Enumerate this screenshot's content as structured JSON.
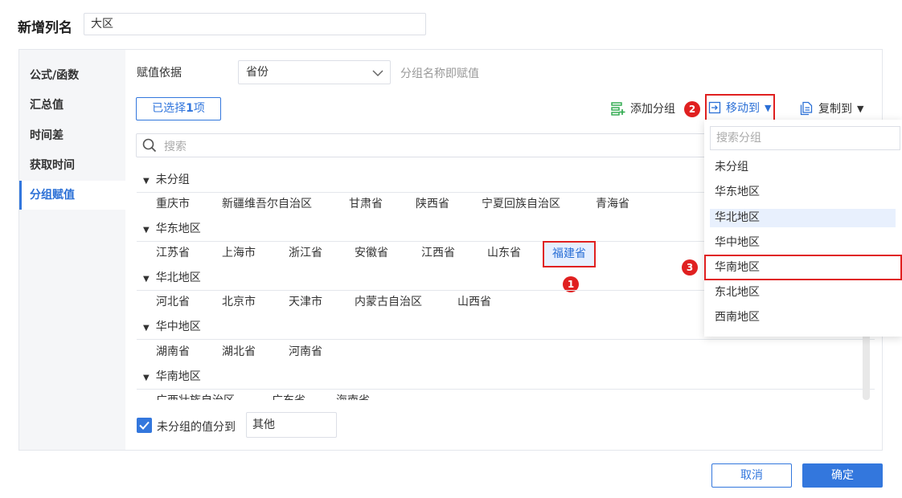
{
  "header": {
    "label": "新增列名",
    "value": "大区"
  },
  "sidebar": {
    "items": [
      {
        "label": "公式/函数"
      },
      {
        "label": "汇总值"
      },
      {
        "label": "时间差"
      },
      {
        "label": "获取时间"
      },
      {
        "label": "分组赋值",
        "active": true
      }
    ]
  },
  "basis": {
    "label": "赋值依据",
    "selected": "省份",
    "hint": "分组名称即赋值"
  },
  "selection": {
    "prefix": "已选择",
    "count": "1",
    "suffix": "项"
  },
  "toolbar": {
    "add_group": "添加分组",
    "move_to": "移动到",
    "copy_to": "复制到",
    "add_icon": "add-group-icon",
    "move_icon": "move-to-icon",
    "copy_icon": "copy-icon"
  },
  "search": {
    "placeholder": "搜索"
  },
  "groups": [
    {
      "name": "未分组",
      "items": [
        "重庆市",
        "新疆维吾尔自治区",
        "甘肃省",
        "陕西省",
        "宁夏回族自治区",
        "青海省"
      ]
    },
    {
      "name": "华东地区",
      "items": [
        "江苏省",
        "上海市",
        "浙江省",
        "安徽省",
        "江西省",
        "山东省",
        "福建省"
      ]
    },
    {
      "name": "华北地区",
      "items": [
        "河北省",
        "北京市",
        "天津市",
        "内蒙古自治区",
        "山西省"
      ]
    },
    {
      "name": "华中地区",
      "items": [
        "湖南省",
        "湖北省",
        "河南省"
      ]
    },
    {
      "name": "华南地区",
      "items": [
        "广西壮族自治区",
        "广东省",
        "海南省"
      ]
    }
  ],
  "unassigned": {
    "label": "未分组的值分到",
    "value": "其他",
    "checked": true
  },
  "dropdown": {
    "search_placeholder": "搜索分组",
    "items": [
      "未分组",
      "华东地区",
      "华北地区",
      "华中地区",
      "华南地区",
      "东北地区",
      "西南地区"
    ]
  },
  "badges": {
    "step1": "1",
    "step2": "2",
    "step3": "3"
  },
  "buttons": {
    "cancel": "取消",
    "ok": "确定"
  },
  "colors": {
    "accent": "#3377dd",
    "highlight": "#e02020"
  }
}
